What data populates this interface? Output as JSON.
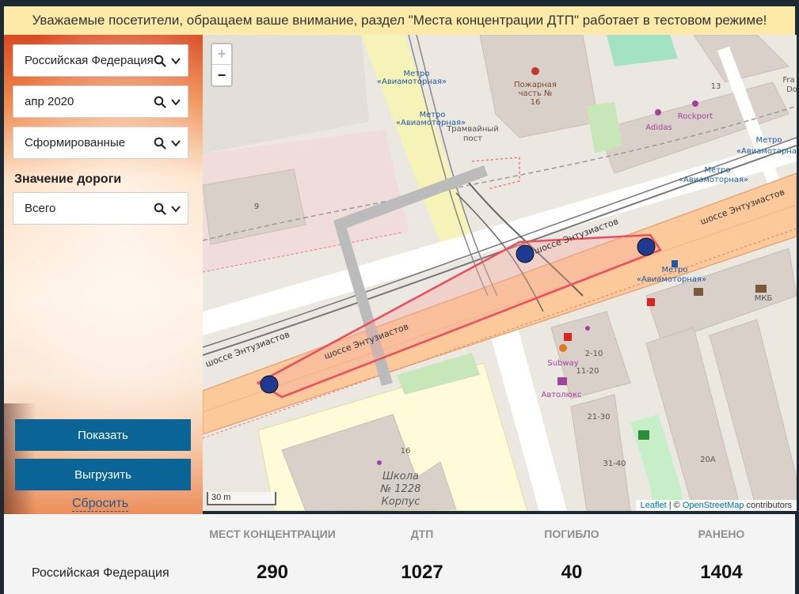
{
  "banner": {
    "text": "Уважаемые посетители, обращаем ваше внимание, раздел \"Места концентрации ДТП\" работает в тестовом режиме!"
  },
  "filters": {
    "region": {
      "value": "Российская Федерация"
    },
    "period": {
      "value": "апр 2020"
    },
    "status": {
      "value": "Сформированные"
    },
    "road_label": "Значение дороги",
    "road": {
      "value": "Всего"
    }
  },
  "buttons": {
    "show": "Показать",
    "export": "Выгрузить",
    "reset": "Сбросить"
  },
  "map": {
    "zoom_in": "+",
    "zoom_out": "−",
    "scale": "30 m",
    "attribution": {
      "leaflet": "Leaflet",
      "sep": " | © ",
      "osm": "OpenStreetMap",
      "contrib": " contributors"
    },
    "labels": {
      "metro": "Метро",
      "metro_station": "«Авиамоторная»",
      "fire1": "Пожарная",
      "fire2": "часть №",
      "fire3": "16",
      "tram1": "Трамвайный",
      "tram2": "пост",
      "adidas": "Adidas",
      "rockport": "Rockport",
      "road": "шоссе Энтузиастов",
      "school1": "Школа",
      "school2": "№ 1228",
      "school3": "Корпус",
      "subway": "Subway",
      "avtolux": "Автолюкс",
      "mkb": "МКБ",
      "n9": "9",
      "n13": "13",
      "n16": "16",
      "n210": "2-10",
      "n1120": "11-20",
      "n2130": "21-30",
      "n3140": "31-40",
      "n20a": "20А",
      "fra": "Fra",
      "do": "Do"
    },
    "marker_color": "#1f3a93",
    "zone_color": "#ef4b5a"
  },
  "stats": {
    "region": "Российская Федерация",
    "columns": [
      {
        "label": "МЕСТ КОНЦЕНТРАЦИИ",
        "value": "290"
      },
      {
        "label": "ДТП",
        "value": "1027"
      },
      {
        "label": "ПОГИБЛО",
        "value": "40"
      },
      {
        "label": "РАНЕНО",
        "value": "1404"
      }
    ]
  }
}
